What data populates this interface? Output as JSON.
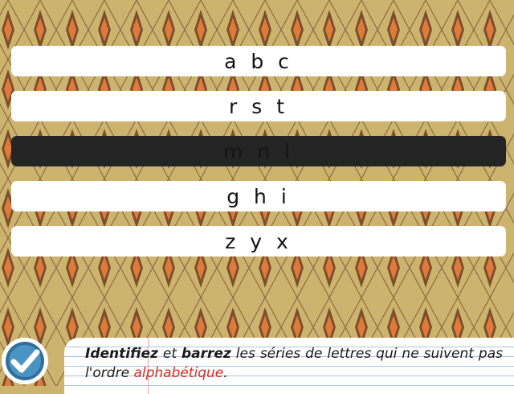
{
  "rows": [
    {
      "label": "a b c",
      "selected": false
    },
    {
      "label": "r s t",
      "selected": false
    },
    {
      "label": "m n l",
      "selected": true
    },
    {
      "label": "g h i",
      "selected": false
    },
    {
      "label": "z y x",
      "selected": false
    }
  ],
  "instruction": {
    "part1": "Identifiez",
    "part2": " et ",
    "part3": "barrez",
    "part4": " les séries de lettres qui ne suivent pas l'ordre ",
    "part5": "alphabétique",
    "part6": "."
  },
  "colors": {
    "background": "#cdb46e",
    "diamond_outer": "#7a4e2e",
    "diamond_inner": "#e07a3a",
    "selected_row": "#242424",
    "check_ring": "#3a7fae",
    "accent_red": "#e0261d"
  },
  "icons": {
    "validate": "check-icon"
  }
}
